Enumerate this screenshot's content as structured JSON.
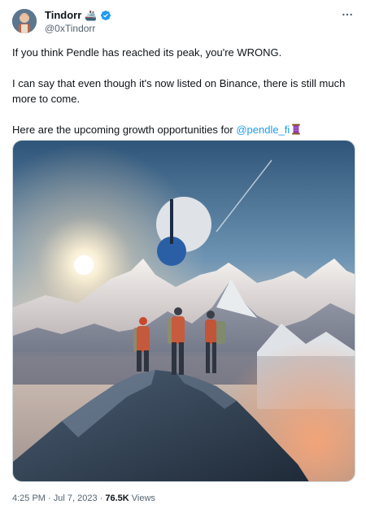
{
  "author": {
    "name": "Tindorr",
    "name_emoji": "🚢",
    "handle": "@0xTindorr"
  },
  "more_icon": "more-horizontal-icon",
  "verified_icon": "verified-badge-icon",
  "tweet": {
    "p1": "If you think Pendle has reached its peak, you're WRONG.",
    "p2": "I can say that even though it's now listed on Binance, there is still much more to come.",
    "p3_before": "Here are the upcoming growth opportunities for ",
    "mention": "@pendle_fi",
    "mention_emoji": "thread-spool-emoji"
  },
  "meta": {
    "time": "4:25 PM",
    "sep1": " · ",
    "date": "Jul 7, 2023",
    "sep2": " · ",
    "views_count": "76.5K",
    "views_label": " Views"
  },
  "colors": {
    "link": "#1d9bf0",
    "verified": "#1d9bf0",
    "secondary": "#536471"
  }
}
